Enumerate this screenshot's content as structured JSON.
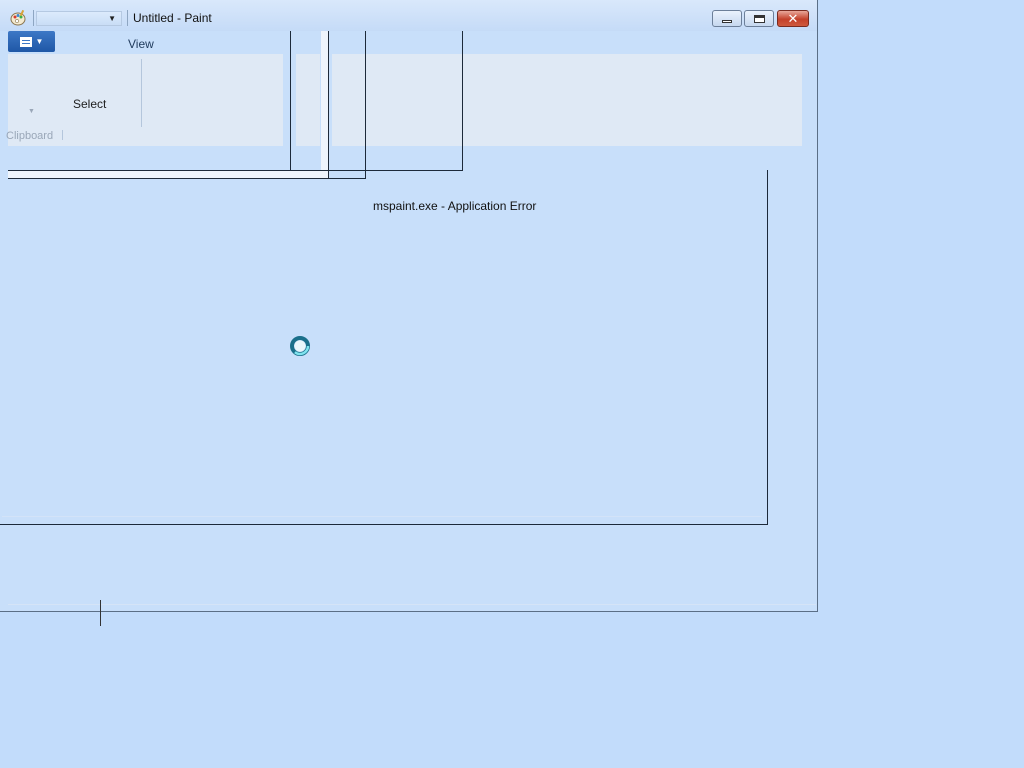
{
  "window": {
    "title": "Untitled - Paint",
    "app_icon": "paint-palette-icon",
    "caption_buttons": {
      "minimize_icon": "minimize-icon",
      "maximize_icon": "maximize-icon",
      "close_icon": "close-icon",
      "close_glyph": "✕"
    }
  },
  "ribbon": {
    "app_menu_icon": "ribbon-menu-icon",
    "tabs": {
      "view": "View"
    },
    "groups": {
      "select_label": "Select",
      "clipboard_label": "Clipboard"
    }
  },
  "error_dialog": {
    "title": "mspaint.exe - Application Error"
  },
  "cursor": {
    "icon": "busy-spinner-icon"
  },
  "colors": {
    "desktop_bg": "#c2dcfb",
    "close_button": "#c4412b",
    "app_menu": "#1f57a6"
  }
}
